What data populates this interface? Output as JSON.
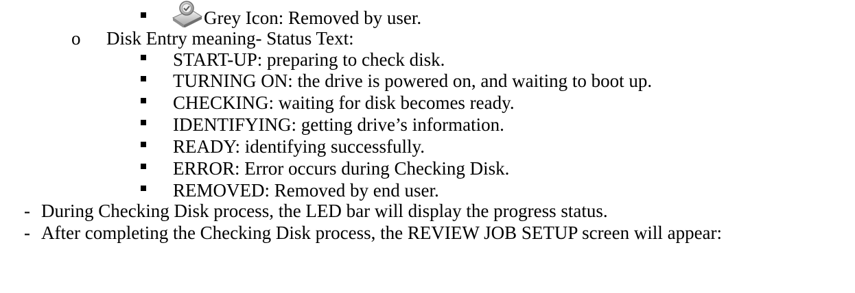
{
  "grey_icon_item": {
    "icon": "grey-disk-icon",
    "text": "Grey Icon: Removed by user."
  },
  "status_section": {
    "heading": "Disk Entry meaning- Status Text:",
    "items": [
      "START-UP:  preparing to check disk.",
      "TURNING ON: the drive is powered on, and waiting to boot up.",
      "CHECKING: waiting for disk becomes ready.",
      "IDENTIFYING: getting drive’s information.",
      "READY: identifying successfully.",
      "ERROR: Error occurs during Checking Disk.",
      "REMOVED: Removed by end user."
    ]
  },
  "dash_items": [
    "During Checking Disk process, the LED bar will display the progress status.",
    "After completing the Checking Disk process, the REVIEW JOB SETUP screen will appear:"
  ],
  "markers": {
    "circle": "o",
    "dash": "-"
  }
}
